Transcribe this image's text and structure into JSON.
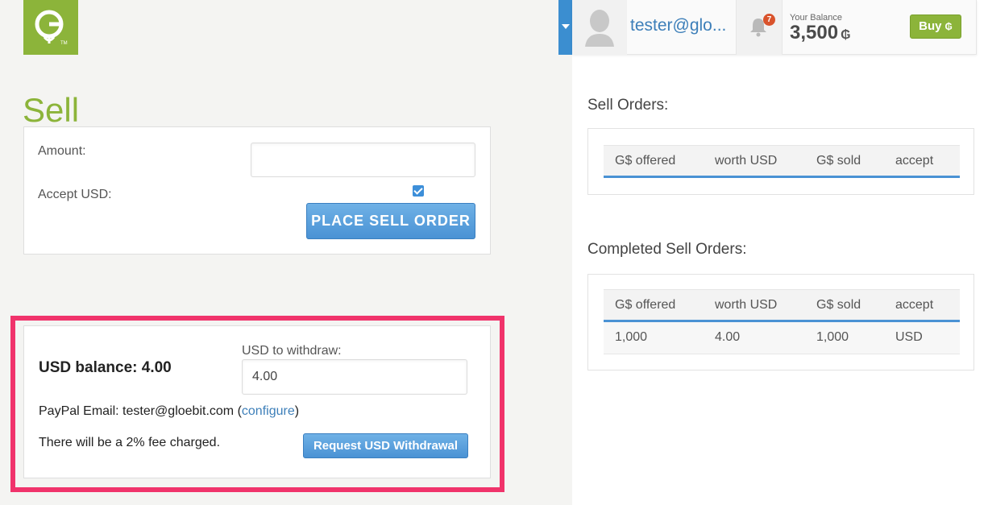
{
  "header": {
    "user_name": "tester@glo...",
    "notification_count": "7",
    "balance_label": "Your Balance",
    "balance_value": "3,500",
    "balance_unit": "₲",
    "buy_label": "Buy",
    "buy_unit": "₲"
  },
  "sell": {
    "title": "Sell",
    "amount_label": "Amount:",
    "amount_value": "",
    "accept_usd_label": "Accept USD:",
    "accept_usd_checked": true,
    "place_order_label": "PLACE SELL ORDER"
  },
  "withdraw": {
    "usd_balance_label": "USD balance: 4.00",
    "withdraw_label": "USD to withdraw:",
    "withdraw_value": "4.00",
    "paypal_prefix": "PayPal Email: tester@gloebit.com (",
    "configure_label": "configure",
    "paypal_suffix": ")",
    "fee_text": "There will be a 2% fee charged.",
    "request_label": "Request USD Withdrawal"
  },
  "sell_orders": {
    "title": "Sell Orders:",
    "columns": [
      "G$ offered",
      "worth USD",
      "G$ sold",
      "accept"
    ],
    "rows": []
  },
  "completed_orders": {
    "title": "Completed Sell Orders:",
    "columns": [
      "G$ offered",
      "worth USD",
      "G$ sold",
      "accept"
    ],
    "rows": [
      [
        "1,000",
        "4.00",
        "1,000",
        "USD"
      ]
    ]
  },
  "colors": {
    "brand_green": "#8cb43a",
    "accent_blue": "#4a92d4",
    "highlight_pink": "#f0336b"
  }
}
